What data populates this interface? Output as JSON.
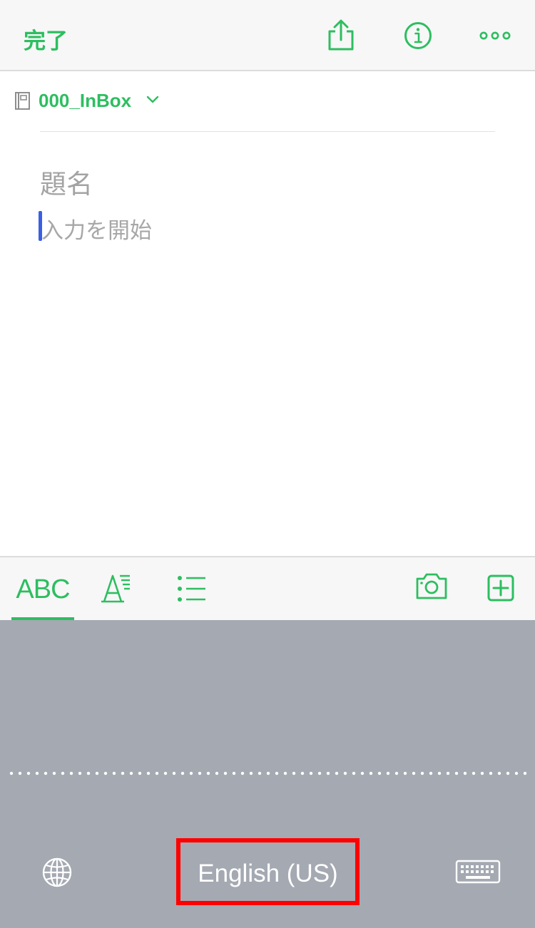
{
  "header": {
    "done_label": "完了",
    "icons": [
      "share-icon",
      "info-icon",
      "more-icon"
    ]
  },
  "notebook": {
    "name": "000_InBox",
    "icon": "notebook-icon",
    "dropdown_icon": "chevron-down-icon"
  },
  "editor": {
    "title_placeholder": "題名",
    "body_placeholder": "入力を開始"
  },
  "toolbar": {
    "abc_label": "ABC",
    "icons": [
      "text-format-icon",
      "list-icon",
      "camera-icon",
      "add-icon"
    ],
    "active_tab": "ABC"
  },
  "keyboard": {
    "language_label": "English (US)",
    "icons": [
      "globe-icon",
      "keyboard-icon"
    ]
  },
  "colors": {
    "accent": "#2dbe60",
    "caret": "#3a5fe5",
    "keyboard_bg": "#a4a9b2",
    "highlight": "#ff0000"
  }
}
